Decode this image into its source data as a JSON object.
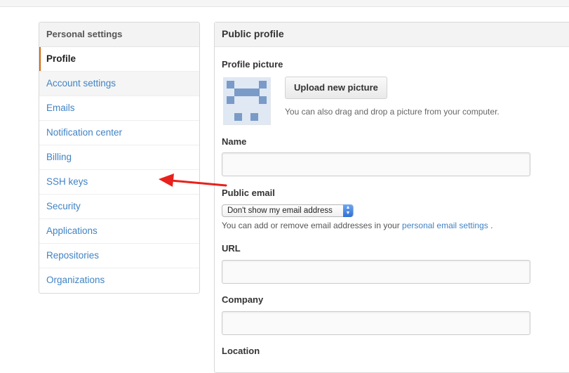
{
  "sidebar": {
    "title": "Personal settings",
    "items": [
      {
        "label": "Profile"
      },
      {
        "label": "Account settings"
      },
      {
        "label": "Emails"
      },
      {
        "label": "Notification center"
      },
      {
        "label": "Billing"
      },
      {
        "label": "SSH keys"
      },
      {
        "label": "Security"
      },
      {
        "label": "Applications"
      },
      {
        "label": "Repositories"
      },
      {
        "label": "Organizations"
      }
    ]
  },
  "main": {
    "title": "Public profile",
    "profile_picture": {
      "label": "Profile picture",
      "upload_button": "Upload new picture",
      "hint": "You can also drag and drop a picture from your computer."
    },
    "name": {
      "label": "Name",
      "value": ""
    },
    "public_email": {
      "label": "Public email",
      "selected": "Don't show my email address",
      "note_prefix": "You can add or remove email addresses in your",
      "note_link": "personal email settings",
      "note_suffix": "."
    },
    "url": {
      "label": "URL",
      "value": ""
    },
    "company": {
      "label": "Company",
      "value": ""
    },
    "location": {
      "label": "Location"
    }
  },
  "annotation": {
    "arrow_color": "#e8211c",
    "icon": "red-arrow-icon"
  },
  "colors": {
    "link": "#4183c4",
    "selected_accent": "#d26911"
  }
}
